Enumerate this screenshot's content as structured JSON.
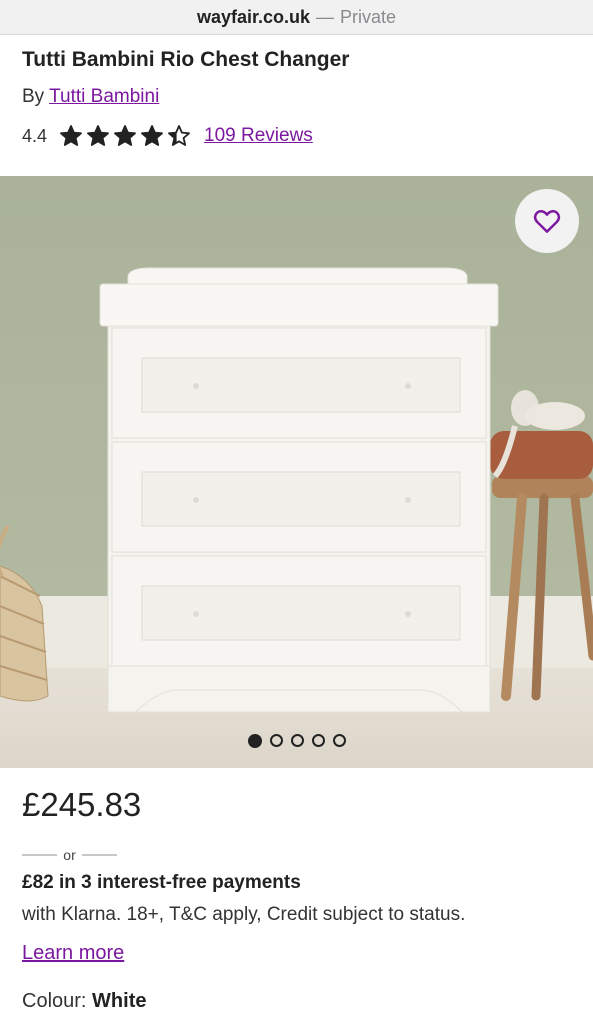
{
  "browser": {
    "domain": "wayfair.co.uk",
    "separator": "—",
    "mode": "Private"
  },
  "product": {
    "title": "Tutti Bambini Rio Chest Changer",
    "by_prefix": "By",
    "brand": "Tutti Bambini",
    "rating": "4.4",
    "rating_value": 4.4,
    "rating_max": 5,
    "reviews_label": "109 Reviews",
    "carousel_total": 5,
    "carousel_active": 1
  },
  "pricing": {
    "price": "£245.83",
    "or": "or",
    "klarna_headline": "£82 in 3 interest-free payments",
    "klarna_note": "with Klarna. 18+, T&C apply, Credit subject to status.",
    "learn_more": "Learn more"
  },
  "options": {
    "colour_label": "Colour:",
    "colour_value": "White"
  },
  "colors": {
    "link": "#7b189f",
    "text": "#222222",
    "wall": "#aab39a"
  },
  "icons": {
    "favorite": "heart-icon",
    "rating": "star-icon"
  }
}
